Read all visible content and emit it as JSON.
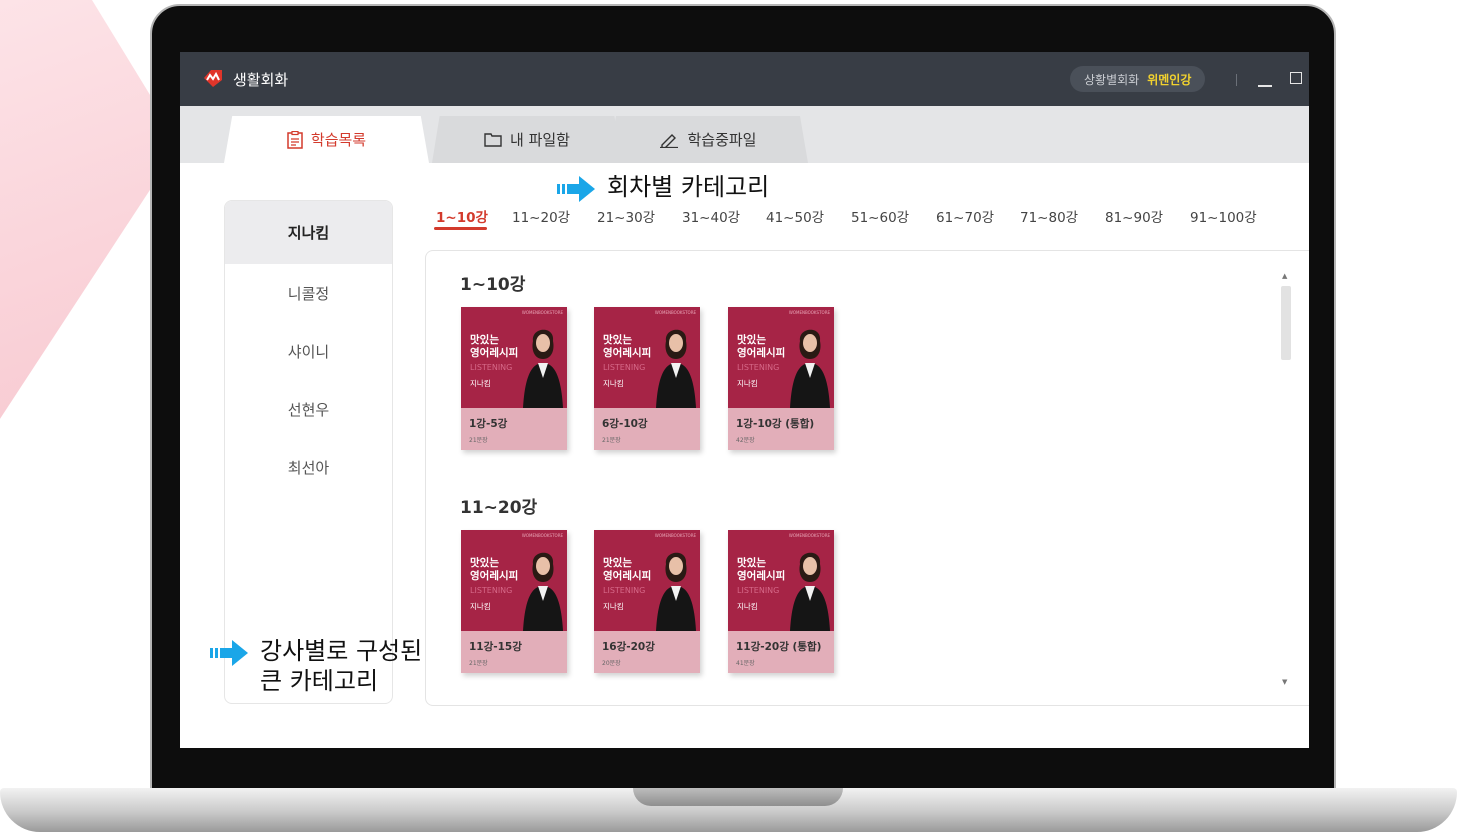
{
  "app": {
    "title": "생활회화"
  },
  "titlebar": {
    "pill_label": "상황별회화",
    "pill_value": "위멘인강"
  },
  "tabs": [
    {
      "label": "학습목록",
      "icon": "list-doc-icon"
    },
    {
      "label": "내 파일함",
      "icon": "folder-icon"
    },
    {
      "label": "학습중파일",
      "icon": "pencil-icon"
    }
  ],
  "sidebar": {
    "items": [
      {
        "label": "지나킴",
        "active": true
      },
      {
        "label": "니콜정"
      },
      {
        "label": "샤이니"
      },
      {
        "label": "선현우"
      },
      {
        "label": "최선아"
      }
    ]
  },
  "episodes": [
    "1~10강",
    "11~20강",
    "21~30강",
    "31~40강",
    "41~50강",
    "51~60강",
    "61~70강",
    "71~80강",
    "81~90강",
    "91~100강"
  ],
  "sections": [
    {
      "title": "1~10강",
      "cards": [
        {
          "title": "1강-5강",
          "count": "21문장"
        },
        {
          "title": "6강-10강",
          "count": "21문장"
        },
        {
          "title": "1강-10강 (통합)",
          "count": "42문장"
        }
      ]
    },
    {
      "title": "11~20강",
      "cards": [
        {
          "title": "11강-15강",
          "count": "21문장"
        },
        {
          "title": "16강-20강",
          "count": "20문장"
        },
        {
          "title": "11강-20강 (통합)",
          "count": "41문장"
        }
      ]
    }
  ],
  "card_cover": {
    "book_line1": "맛있는",
    "book_line2": "영어레시피",
    "subtitle": "LISTENING",
    "teacher": "지나킴",
    "top_text": "WOMENBOOKSTORE"
  },
  "callouts": {
    "episode": "회차별 카테고리",
    "teacher_line1": "강사별로 구성된",
    "teacher_line2": "큰 카테고리"
  },
  "colors": {
    "accent": "#d33a2c",
    "titlebar": "#383d45",
    "cover": "#a62446",
    "callout_arrow": "#1aa6e8"
  }
}
